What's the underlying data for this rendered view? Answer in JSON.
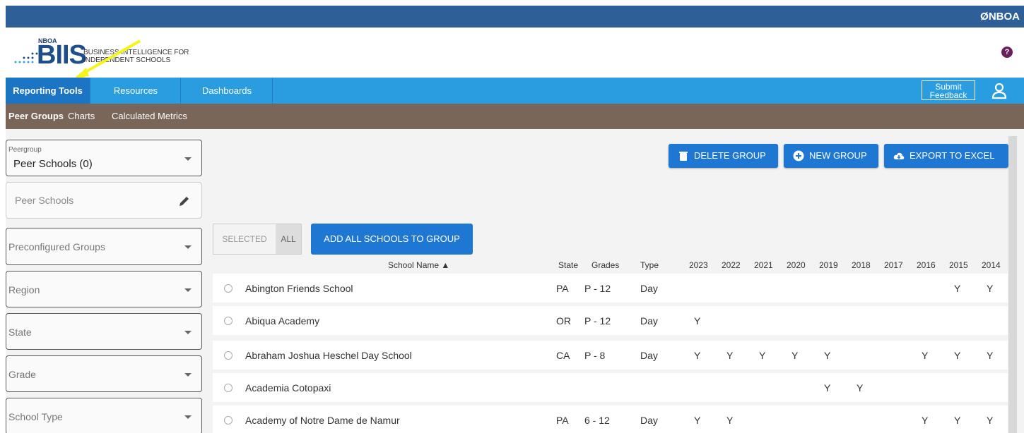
{
  "header": {
    "brand": "ØNBOA"
  },
  "logo": {
    "org": "NBOA",
    "product": "BIIS",
    "tagline_line1": "BUSINESS INTELLIGENCE FOR",
    "tagline_line2": "INDEPENDENT SCHOOLS",
    "help": "?"
  },
  "nav": {
    "tabs": [
      "Reporting Tools",
      "Resources",
      "Dashboards"
    ],
    "feedback_line1": "Submit",
    "feedback_line2": "Feedback"
  },
  "subnav": {
    "tabs": [
      "Peer Groups",
      "Charts",
      "Calculated Metrics"
    ]
  },
  "filters": {
    "peergroup_label": "Peergroup",
    "peergroup_value": "Peer Schools (0)",
    "peer_schools_placeholder": "Peer Schools",
    "preconfigured": "Preconfigured Groups",
    "region": "Region",
    "state": "State",
    "grade": "Grade",
    "school_type": "School Type"
  },
  "actions": {
    "delete": "DELETE GROUP",
    "new": "NEW GROUP",
    "export": "EXPORT TO EXCEL"
  },
  "toggle": {
    "selected": "SELECTED",
    "all": "ALL"
  },
  "add_all": "ADD ALL SCHOOLS TO GROUP",
  "table": {
    "headers": {
      "name": "School Name",
      "state": "State",
      "grades": "Grades",
      "type": "Type",
      "years": [
        "2023",
        "2022",
        "2021",
        "2020",
        "2019",
        "2018",
        "2017",
        "2016",
        "2015",
        "2014"
      ]
    },
    "rows": [
      {
        "name": "Abington Friends School",
        "state": "PA",
        "grades": "P - 12",
        "type": "Day",
        "years": [
          "",
          "",
          "",
          "",
          "",
          "",
          "",
          "",
          "Y",
          "Y"
        ]
      },
      {
        "name": "Abiqua Academy",
        "state": "OR",
        "grades": "P - 12",
        "type": "Day",
        "years": [
          "Y",
          "",
          "",
          "",
          "",
          "",
          "",
          "",
          "",
          ""
        ]
      },
      {
        "name": "Abraham Joshua Heschel Day School",
        "state": "CA",
        "grades": "P - 8",
        "type": "Day",
        "years": [
          "Y",
          "Y",
          "Y",
          "Y",
          "Y",
          "",
          "",
          "Y",
          "Y",
          "Y"
        ]
      },
      {
        "name": "Academia Cotopaxi",
        "state": "",
        "grades": "",
        "type": "",
        "years": [
          "",
          "",
          "",
          "",
          "Y",
          "Y",
          "",
          "",
          "",
          ""
        ]
      },
      {
        "name": "Academy of Notre Dame de Namur",
        "state": "PA",
        "grades": "6 - 12",
        "type": "Day",
        "years": [
          "Y",
          "Y",
          "",
          "",
          "",
          "",
          "",
          "Y",
          "Y",
          "Y"
        ]
      }
    ]
  }
}
